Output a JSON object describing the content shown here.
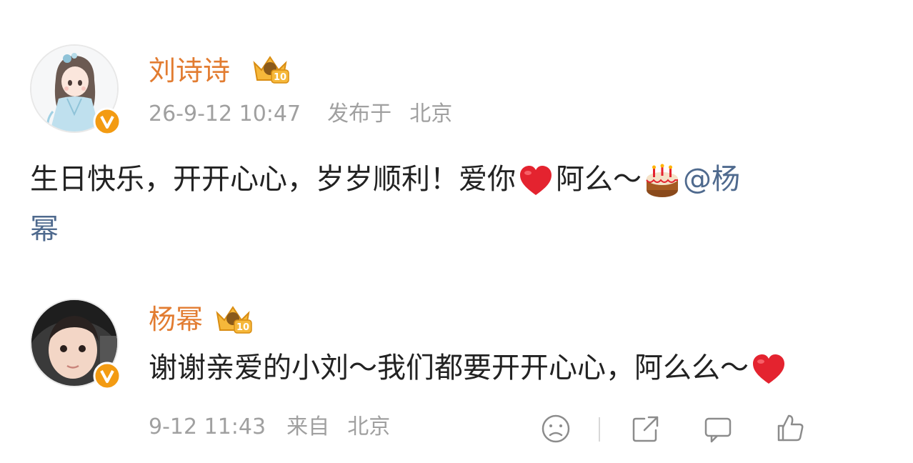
{
  "post": {
    "author_name": "刘诗诗",
    "level_badge": "10",
    "timestamp": "26-9-12 10:47",
    "location_prefix": "发布于",
    "location": "北京",
    "text_part1": "生日快乐，开开心心，岁岁顺利！爱你",
    "text_part2": "阿么～",
    "mention_line1": "@杨",
    "mention_line2": "幂",
    "avatar_icon": "illustrated-girl-avatar",
    "verified_icon": "v-verified-icon",
    "emoji_heart": "heart-emoji",
    "emoji_cake": "birthday-cake-emoji"
  },
  "reply": {
    "author_name": "杨幂",
    "level_badge": "10",
    "text": "谢谢亲爱的小刘～我们都要开开心心，阿么么～",
    "timestamp": "9-12 11:43",
    "location_prefix": "来自",
    "location": "北京",
    "avatar_icon": "child-photo-avatar",
    "verified_icon": "v-verified-icon",
    "emoji_heart": "heart-emoji"
  },
  "actions": [
    {
      "name": "face-icon"
    },
    {
      "name": "share-icon"
    },
    {
      "name": "comment-icon"
    },
    {
      "name": "like-icon"
    }
  ],
  "colors": {
    "name": "#e27c31",
    "mention": "#4f6a8e",
    "meta": "#a0a0a0",
    "body": "#222222",
    "badge": "#f39b12"
  }
}
